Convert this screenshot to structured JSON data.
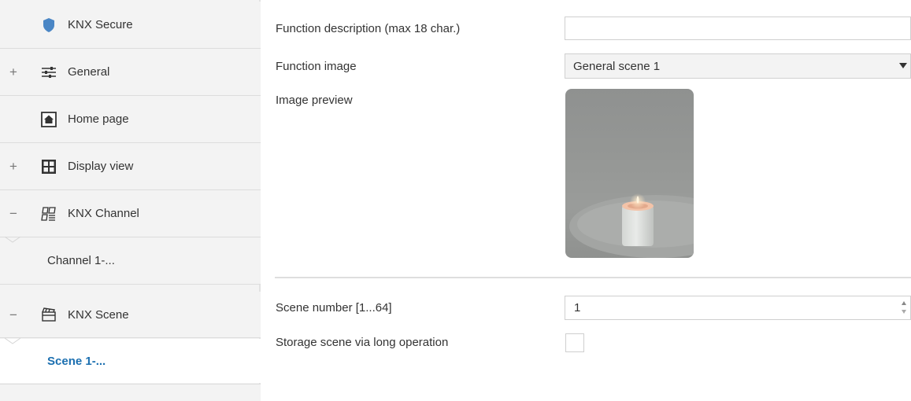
{
  "sidebar": {
    "items": [
      {
        "label": "KNX Secure",
        "icon": "shield-icon",
        "expander": ""
      },
      {
        "label": "General",
        "icon": "sliders-icon",
        "expander": "+"
      },
      {
        "label": "Home page",
        "icon": "home-icon",
        "expander": ""
      },
      {
        "label": "Display view",
        "icon": "grid-icon",
        "expander": "+"
      },
      {
        "label": "KNX Channel",
        "icon": "channel-icon",
        "expander": "−"
      },
      {
        "label": "Channel 1-...",
        "icon": "",
        "expander": ""
      },
      {
        "label": "KNX Scene",
        "icon": "scene-icon",
        "expander": "−"
      },
      {
        "label": "Scene 1-...",
        "icon": "",
        "expander": ""
      }
    ]
  },
  "form": {
    "description_label": "Function description (max 18 char.)",
    "description_value": "",
    "image_label": "Function image",
    "image_value": "General scene 1",
    "preview_label": "Image preview",
    "scene_number_label": "Scene number [1...64]",
    "scene_number_value": "1",
    "storage_label": "Storage scene via long operation",
    "storage_checked": false
  },
  "colors": {
    "accent": "#1b6fb0",
    "shield": "#4a86c5"
  }
}
